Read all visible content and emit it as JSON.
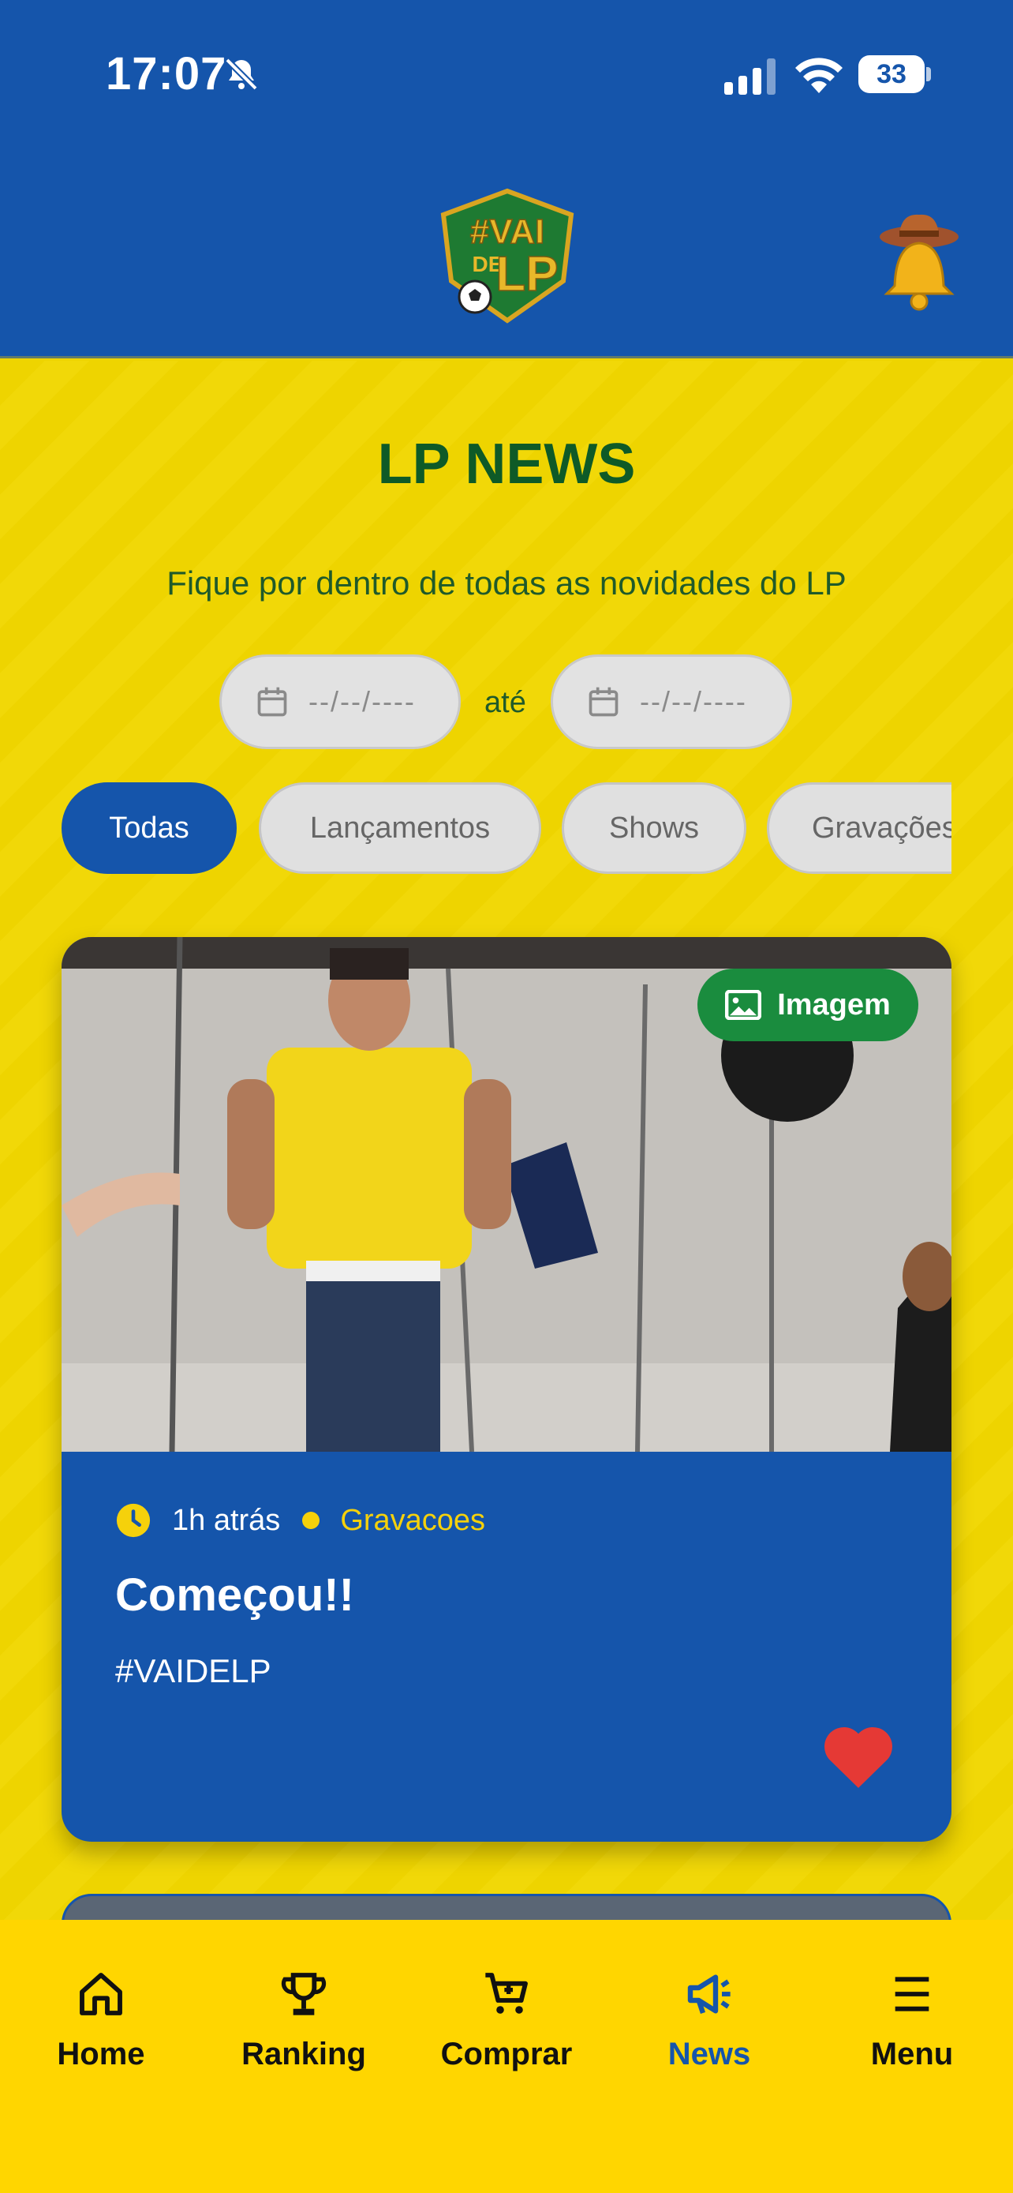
{
  "status_bar": {
    "time": "17:07",
    "battery": "33",
    "icons": [
      "bell-slash-icon",
      "cellular-signal-icon",
      "wifi-icon",
      "battery-icon"
    ]
  },
  "header": {
    "logo_text": "#VAI DE LP",
    "notification_icon": "cowboy-bell-icon"
  },
  "page": {
    "title": "LP NEWS",
    "subtitle": "Fique por dentro de todas as novidades do LP"
  },
  "date_filter": {
    "from_placeholder": "--/--/----",
    "to_placeholder": "--/--/----",
    "separator": "até"
  },
  "categories": [
    {
      "label": "Todas",
      "active": true
    },
    {
      "label": "Lançamentos",
      "active": false
    },
    {
      "label": "Shows",
      "active": false
    },
    {
      "label": "Gravações",
      "active": false
    }
  ],
  "news": [
    {
      "badge": "Imagem",
      "time_ago": "1h atrás",
      "category": "Gravacoes",
      "title": "Começou!!",
      "description": "#VAIDELP",
      "liked": true
    }
  ],
  "bottom_nav": [
    {
      "label": "Home",
      "icon": "home-icon",
      "active": false
    },
    {
      "label": "Ranking",
      "icon": "trophy-icon",
      "active": false
    },
    {
      "label": "Comprar",
      "icon": "cart-icon",
      "active": false
    },
    {
      "label": "News",
      "icon": "megaphone-icon",
      "active": true
    },
    {
      "label": "Menu",
      "icon": "menu-icon",
      "active": false
    }
  ],
  "colors": {
    "primary_blue": "#1555AB",
    "brand_yellow": "#EED400",
    "title_green": "#0E5A27",
    "badge_green": "#1A8C3E",
    "accent_yellow": "#F5D10B",
    "heart_red": "#E53935"
  }
}
